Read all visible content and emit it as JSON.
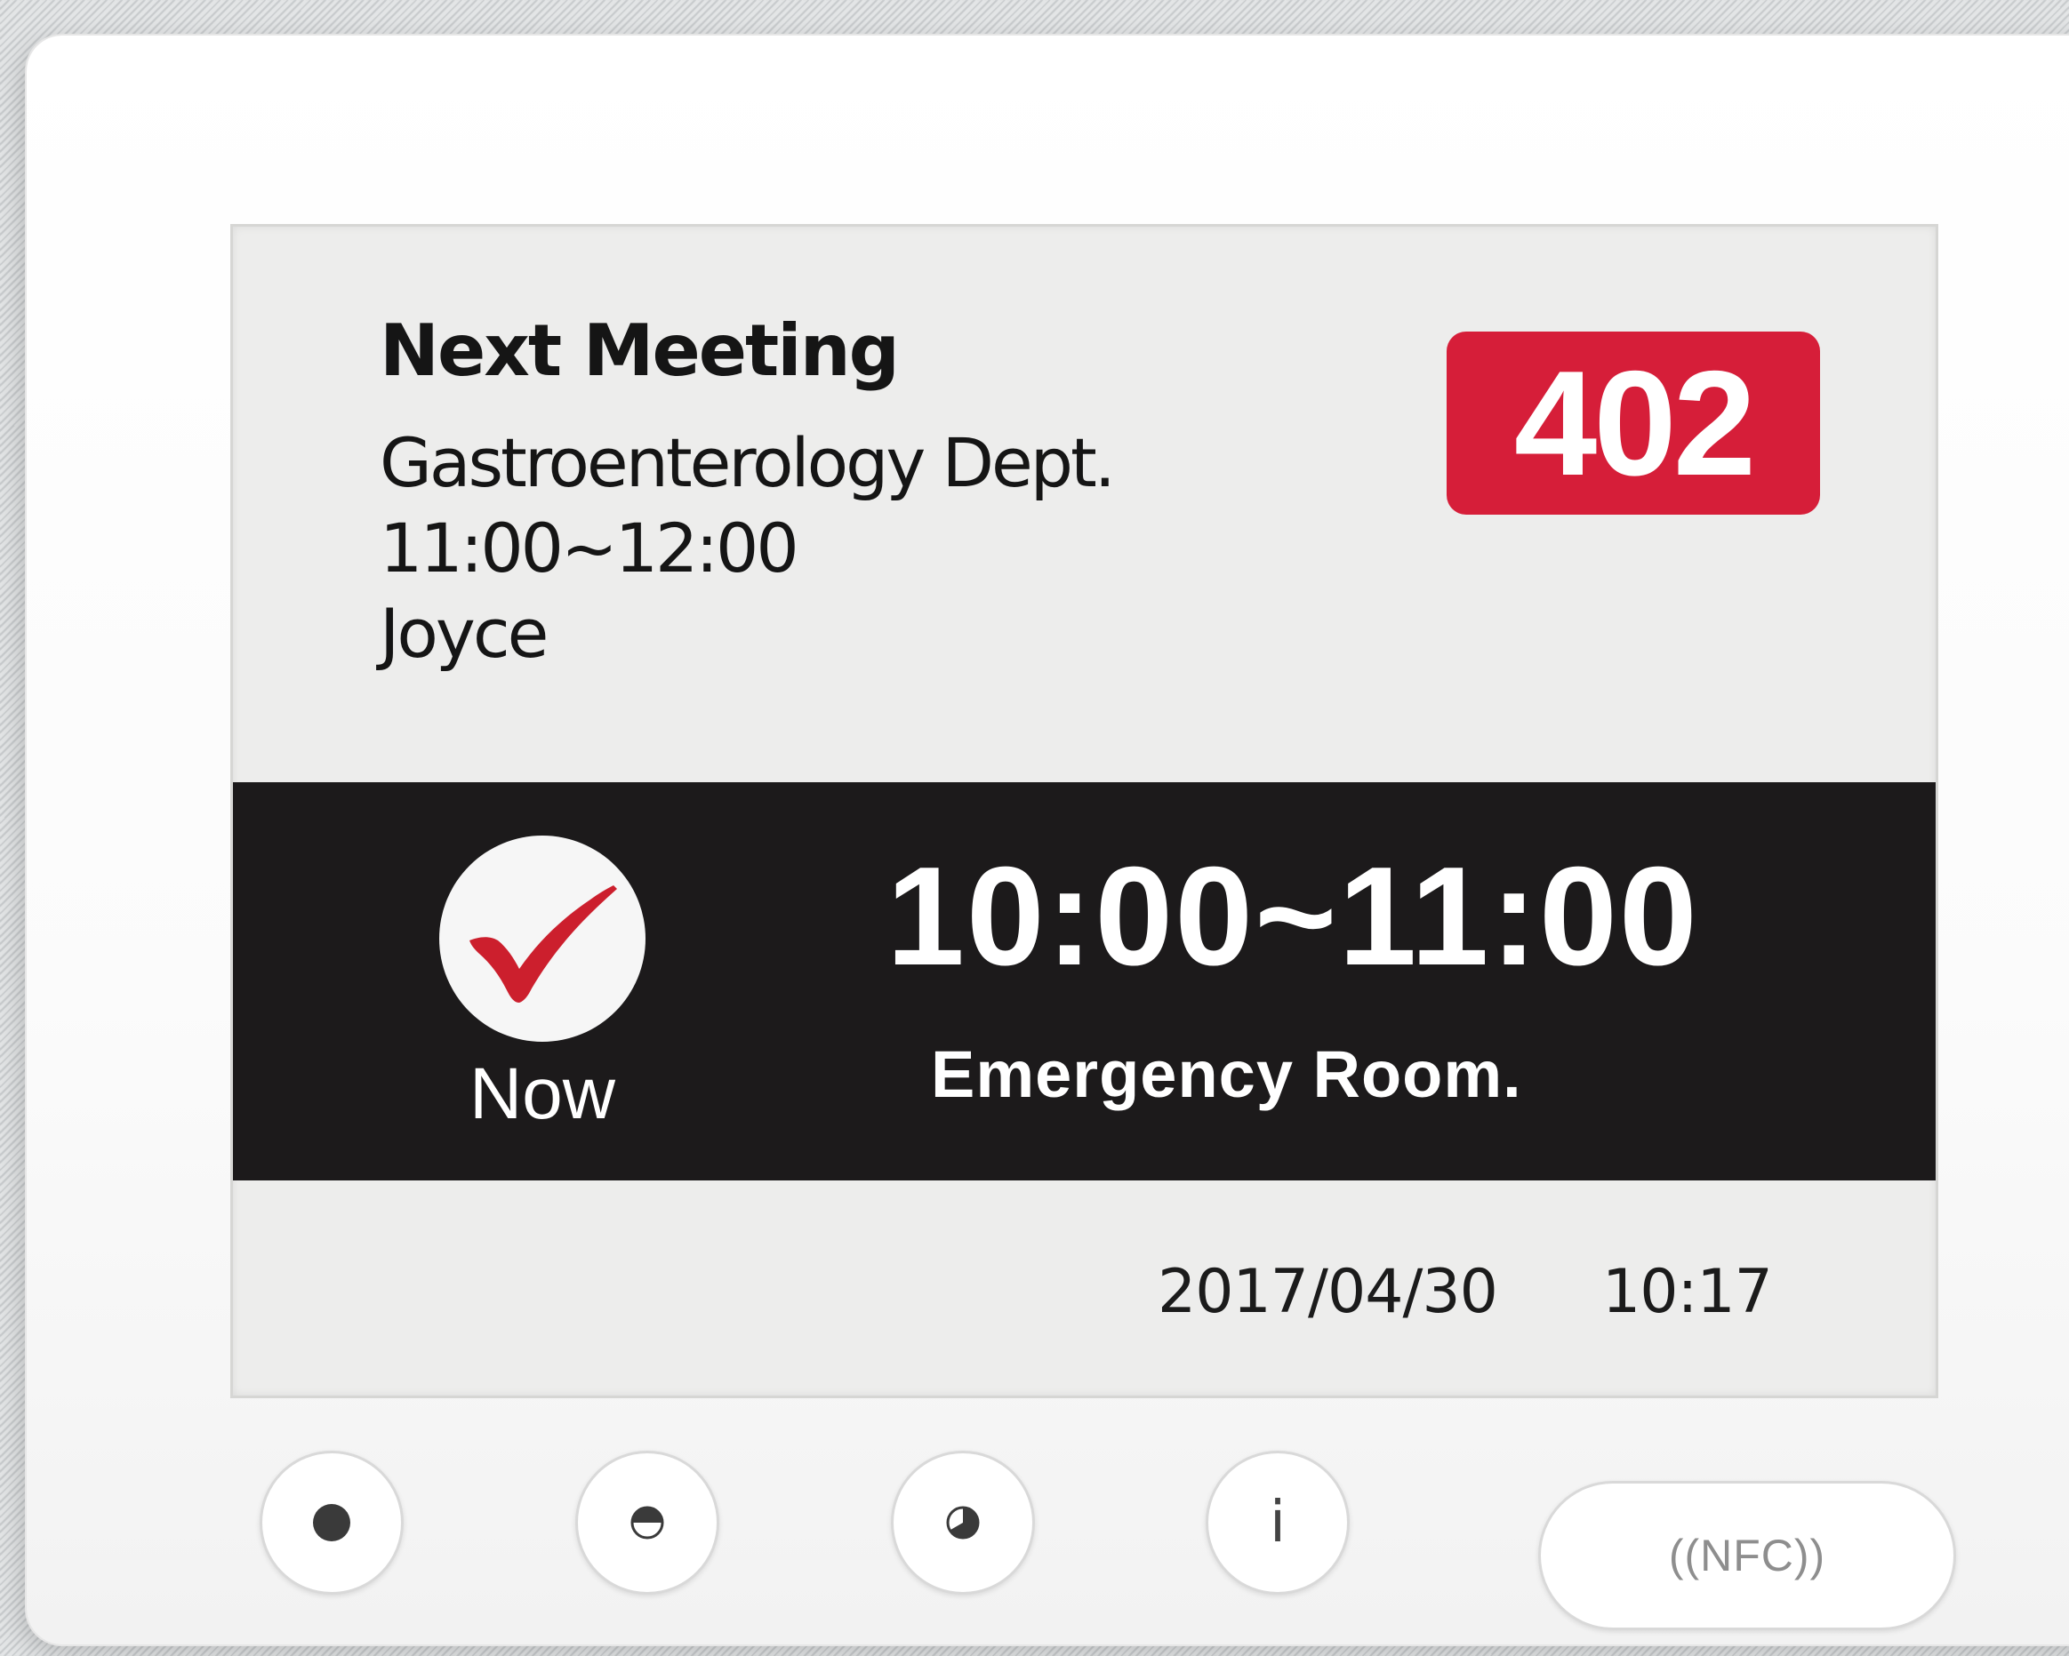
{
  "next_meeting": {
    "title": "Next Meeting",
    "department": "Gastroenterology Dept.",
    "time": "11:00~12:00",
    "host": "Joyce"
  },
  "room_number": "402",
  "current_meeting": {
    "status_label": "Now",
    "time": "10:00~11:00",
    "room": "Emergency Room."
  },
  "footer": {
    "date": "2017/04/30",
    "time": "10:17"
  },
  "buttons": [
    {
      "icon": "filled-dot-icon"
    },
    {
      "icon": "half-circle-icon"
    },
    {
      "icon": "pie-segment-icon"
    },
    {
      "icon": "info-icon",
      "glyph": "i"
    }
  ],
  "nfc_label": "((NFC))",
  "colors": {
    "badge_red": "#d61e39",
    "band_black": "#1c1a1b",
    "check_red": "#cc1f2d",
    "screen_bg": "#ededec"
  }
}
